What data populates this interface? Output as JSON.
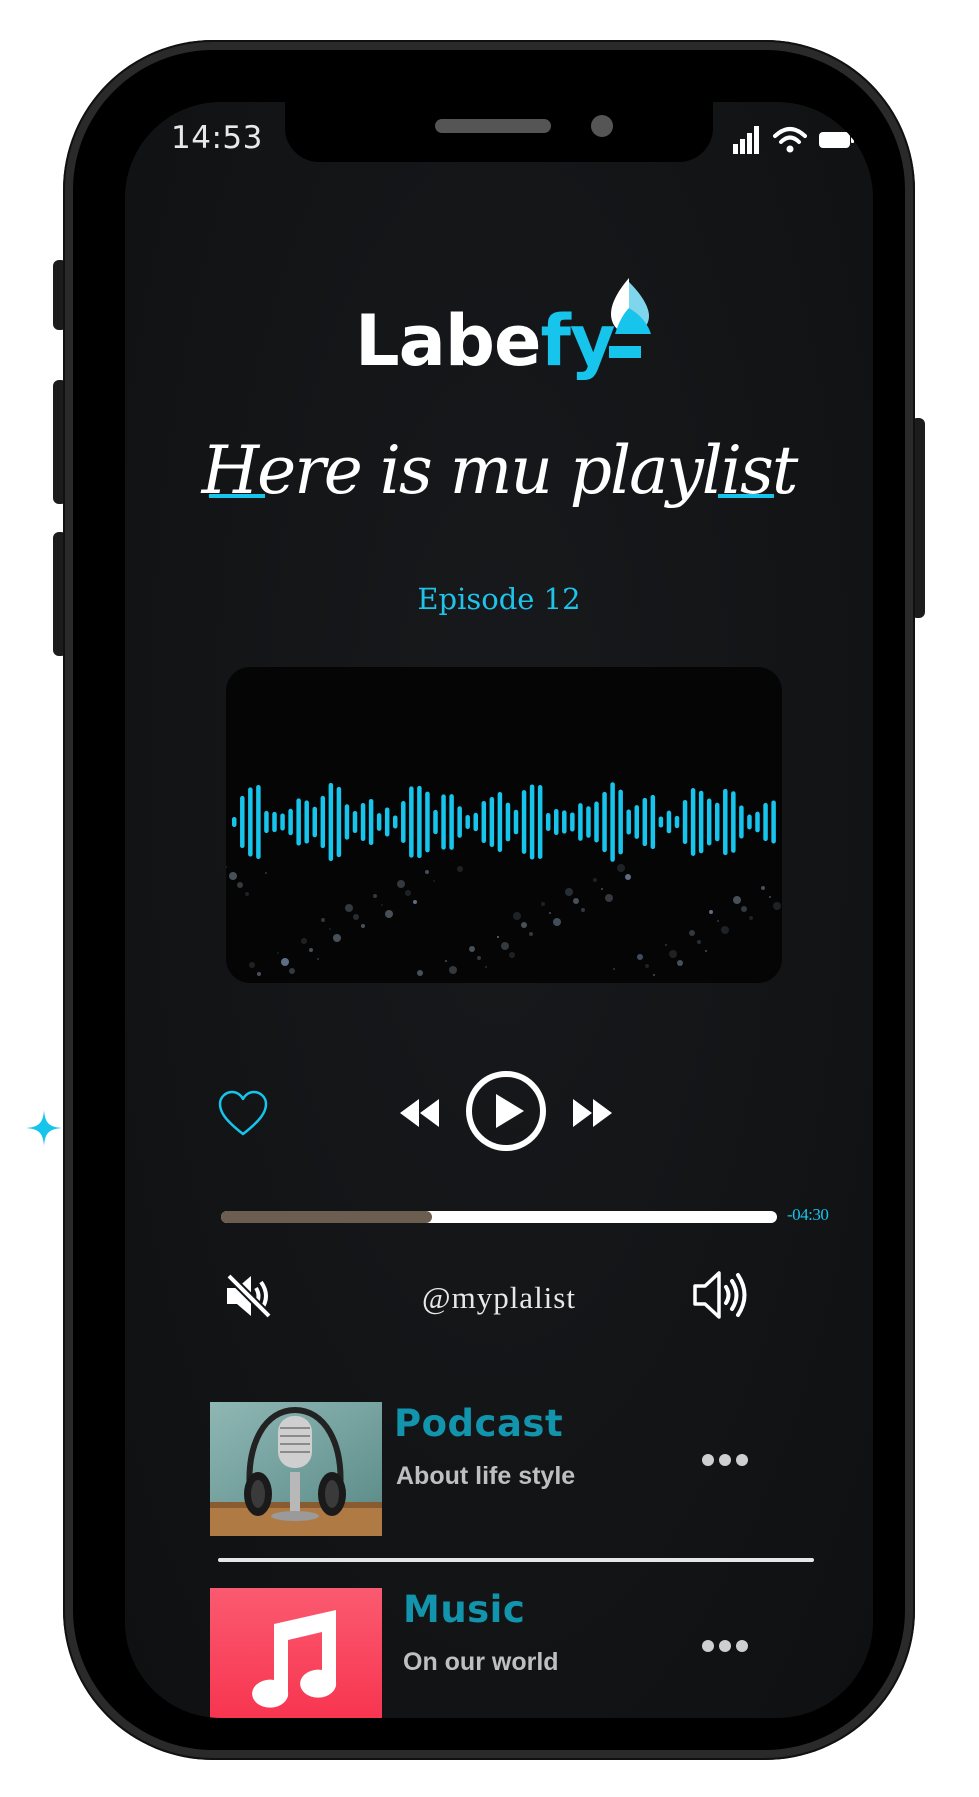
{
  "status_bar": {
    "time": "14:53",
    "signal_icon": "cellular-signal-icon",
    "wifi_icon": "wifi-icon",
    "battery_icon": "battery-icon"
  },
  "app": {
    "logo_text_white": "Labe",
    "logo_text_accent": "fy"
  },
  "header": {
    "title": "Here is mu playlist",
    "episode": "Episode 12"
  },
  "player": {
    "like_icon": "heart-outline-icon",
    "prev_icon": "rewind-icon",
    "play_icon": "play-circle-icon",
    "next_icon": "fast-forward-icon",
    "progress_fraction": 0.38,
    "remaining": "-04:30",
    "mute_icon": "mute-icon",
    "handle": "@myplalist",
    "volume_icon": "volume-icon"
  },
  "list": [
    {
      "title": "Podcast",
      "subtitle": "About life style",
      "thumb": "podcast-microphone-image",
      "more_icon": "more-dots-icon"
    },
    {
      "title": "Music",
      "subtitle": "On our world",
      "thumb": "music-note-app-icon",
      "more_icon": "more-dots-icon"
    }
  ],
  "colors": {
    "accent": "#17c4ec",
    "item_title": "#1294ac",
    "progress_played": "#6b5e51",
    "music_icon_bg": "#f8344f"
  }
}
